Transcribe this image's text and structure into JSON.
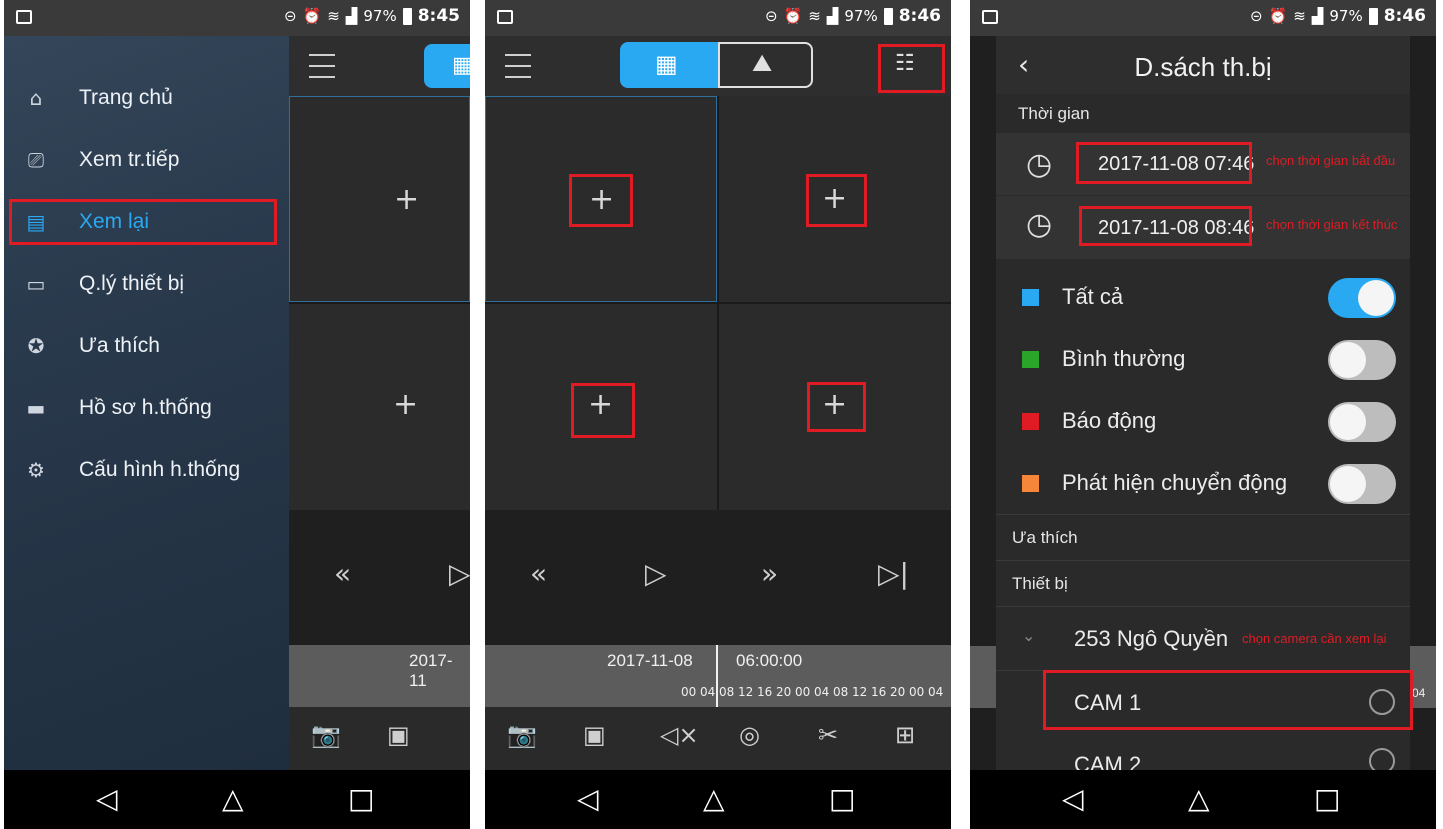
{
  "status_bar": {
    "p1": {
      "battery": "97%",
      "time": "8:45"
    },
    "p2": {
      "battery": "97%",
      "time": "8:46"
    },
    "p3": {
      "battery": "97%",
      "time": "8:46"
    }
  },
  "drawer": {
    "items": [
      {
        "label": "Trang chủ",
        "icon": "home-icon"
      },
      {
        "label": "Xem tr.tiếp",
        "icon": "camera-icon"
      },
      {
        "label": "Xem lại",
        "icon": "playback-icon"
      },
      {
        "label": "Q.lý thiết bị",
        "icon": "device-icon"
      },
      {
        "label": "Ưa thích",
        "icon": "star-icon"
      },
      {
        "label": "Hồ sơ h.thống",
        "icon": "folder-icon"
      },
      {
        "label": "Cấu hình h.thống",
        "icon": "gear-icon"
      }
    ],
    "active_index": 2
  },
  "playback": {
    "p1_date_partial": "2017-11",
    "date": "2017-11-08",
    "time": "06:00:00",
    "ticks": [
      "00",
      "04",
      "08",
      "12",
      "16",
      "20",
      "00",
      "04",
      "08",
      "12",
      "16",
      "20",
      "00",
      "04"
    ],
    "p3_tick_fragment": "04"
  },
  "device_list": {
    "title": "D.sách th.bị",
    "time_section": "Thời gian",
    "start_time": "2017-11-08 07:46",
    "end_time": "2017-11-08 08:46",
    "start_note": "chọn thời gian bắt đầu",
    "end_note": "chọn thời gian kết thúc",
    "filters": [
      {
        "label": "Tất cả",
        "color": "#29a9f2",
        "on": true
      },
      {
        "label": "Bình thường",
        "color": "#2aa52a",
        "on": false
      },
      {
        "label": "Báo động",
        "color": "#e01b24",
        "on": false
      },
      {
        "label": "Phát hiện chuyển động",
        "color": "#f5863a",
        "on": false
      }
    ],
    "favorites_section": "Ưa thích",
    "devices_section": "Thiết bị",
    "device_name": "253 Ngô Quyền",
    "device_note": "chọn camera cần xem lại",
    "cameras": [
      "CAM 1",
      "CAM 2"
    ]
  },
  "colors": {
    "accent": "#29a9f2",
    "highlight": "#e01b24"
  }
}
